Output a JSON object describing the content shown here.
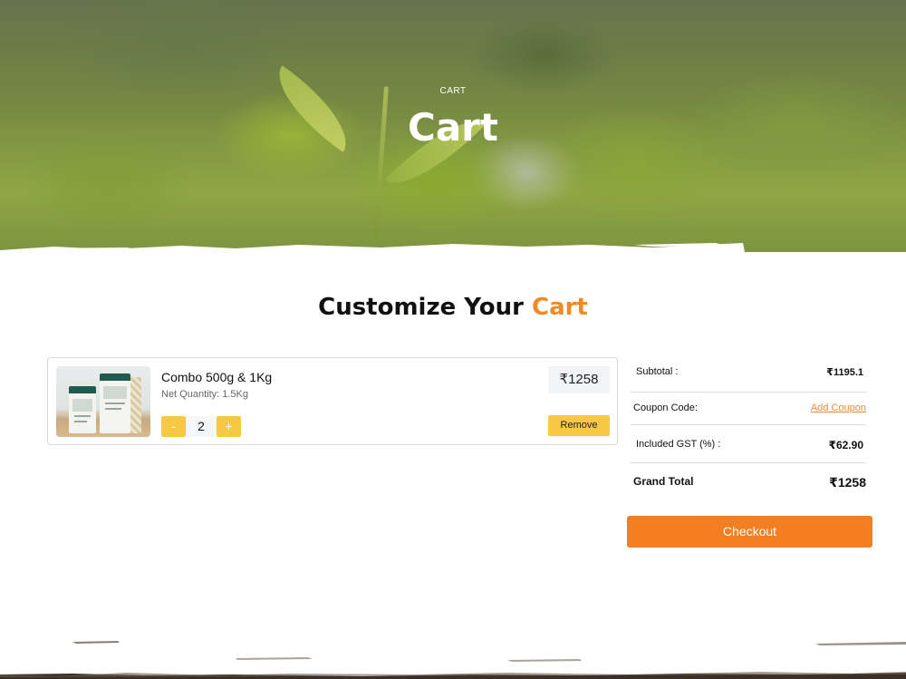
{
  "hero": {
    "breadcrumb": "CART",
    "title": "Cart"
  },
  "section": {
    "title_main": "Customize Your ",
    "title_accent": "Cart"
  },
  "cart_item": {
    "name": "Combo 500g & 1Kg",
    "net_quantity": "Net Quantity: 1.5Kg",
    "quantity": "2",
    "minus_label": "-",
    "plus_label": "+",
    "price": "₹1258",
    "remove_label": "Remove"
  },
  "summary": {
    "subtotal_label": "Subtotal :",
    "subtotal_value": "₹1195.1",
    "coupon_label": "Coupon Code:",
    "coupon_link": "Add Coupon",
    "gst_label": "Included GST (%) :",
    "gst_value": "₹62.90",
    "grand_total_label": "Grand Total",
    "grand_total_value": "₹1258"
  },
  "checkout_label": "Checkout",
  "colors": {
    "accent": "#f08a24",
    "button_yellow": "#f7c844",
    "checkout": "#f37f22"
  }
}
